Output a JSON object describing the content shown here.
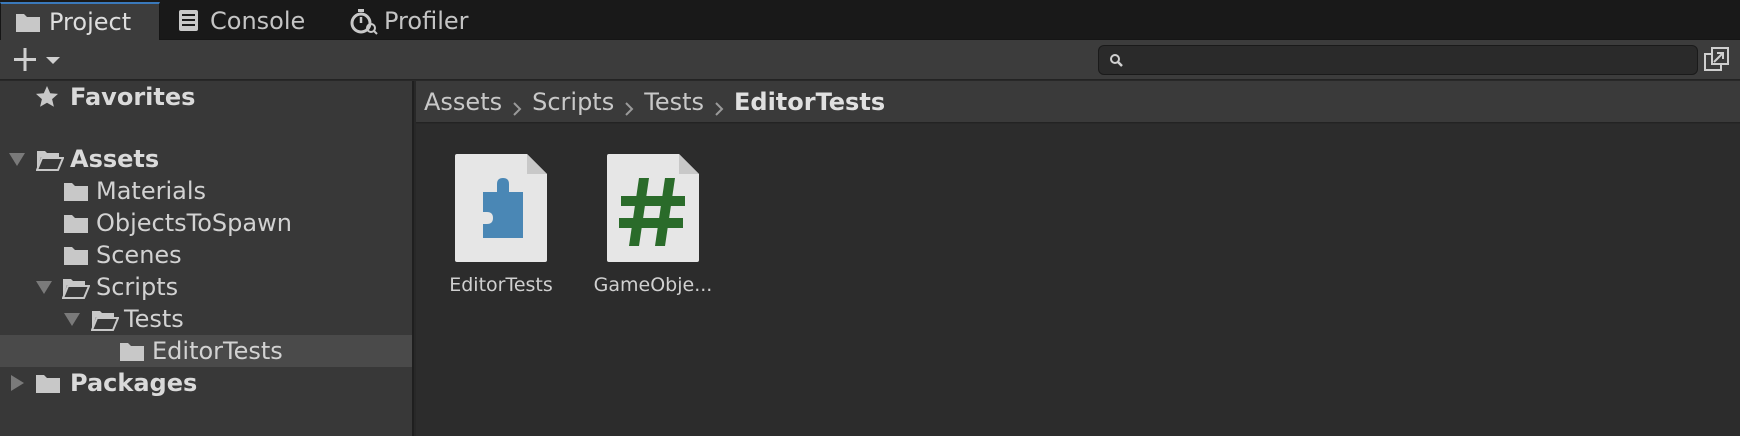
{
  "tabs": [
    {
      "label": "Project",
      "icon": "folder-icon",
      "active": true
    },
    {
      "label": "Console",
      "icon": "console-icon",
      "active": false
    },
    {
      "label": "Profiler",
      "icon": "stopwatch-icon",
      "active": false
    }
  ],
  "toolbar": {
    "create_icon": "plus-icon",
    "search_placeholder": "",
    "search_value": ""
  },
  "tree": {
    "favorites": {
      "label": "Favorites"
    },
    "items": [
      {
        "label": "Assets",
        "depth": 0,
        "expanded": true,
        "bold": true
      },
      {
        "label": "Materials",
        "depth": 1
      },
      {
        "label": "ObjectsToSpawn",
        "depth": 1
      },
      {
        "label": "Scenes",
        "depth": 1
      },
      {
        "label": "Scripts",
        "depth": 1,
        "expanded": true
      },
      {
        "label": "Tests",
        "depth": 2,
        "expanded": true
      },
      {
        "label": "EditorTests",
        "depth": 3,
        "selected": true
      },
      {
        "label": "Packages",
        "depth": 0,
        "expanded": false,
        "bold": true
      }
    ]
  },
  "breadcrumb": [
    "Assets",
    "Scripts",
    "Tests",
    "EditorTests"
  ],
  "assets": [
    {
      "name": "EditorTests",
      "icon": "assembly-definition-icon",
      "accent": "#4a87b5"
    },
    {
      "name": "GameObje...",
      "icon": "csharp-script-icon",
      "accent": "#2a6b2a"
    }
  ],
  "colors": {
    "accent": "#3a79bb",
    "selected_row": "#4a4a4a"
  }
}
